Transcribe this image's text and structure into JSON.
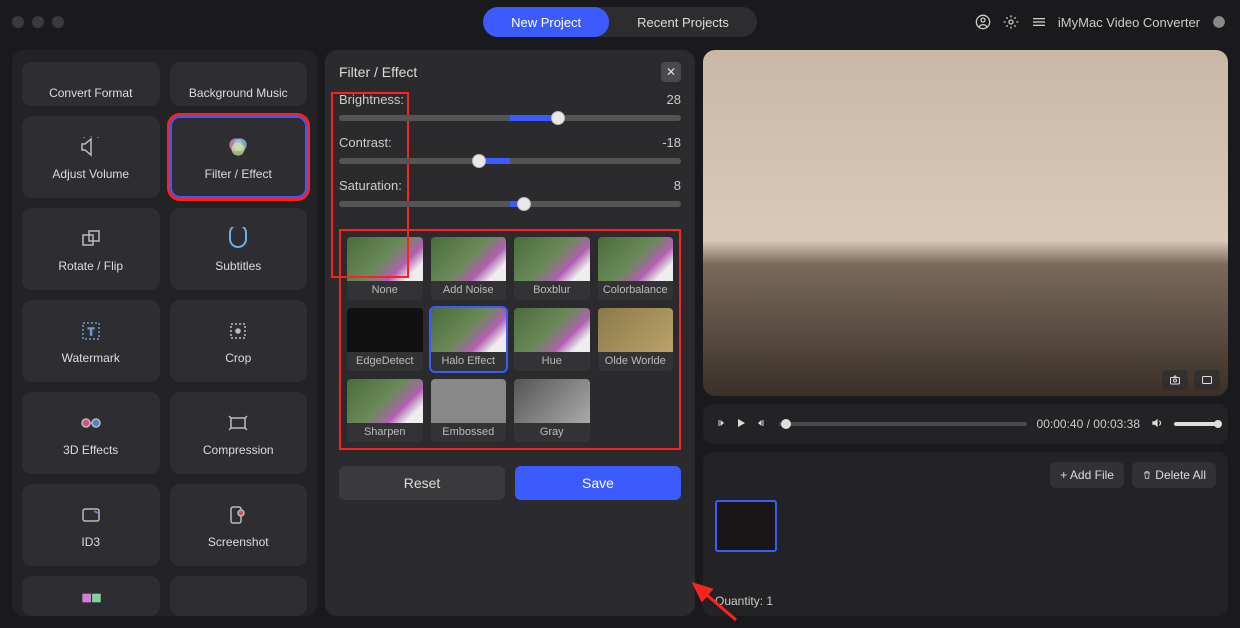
{
  "header": {
    "new_project": "New Project",
    "recent_projects": "Recent Projects",
    "app_name": "iMyMac Video Converter"
  },
  "sidebar": {
    "tools": [
      {
        "label": "Convert Format"
      },
      {
        "label": "Background Music"
      },
      {
        "label": "Adjust Volume"
      },
      {
        "label": "Filter / Effect"
      },
      {
        "label": "Rotate / Flip"
      },
      {
        "label": "Subtitles"
      },
      {
        "label": "Watermark"
      },
      {
        "label": "Crop"
      },
      {
        "label": "3D Effects"
      },
      {
        "label": "Compression"
      },
      {
        "label": "ID3"
      },
      {
        "label": "Screenshot"
      }
    ]
  },
  "editor": {
    "title": "Filter / Effect",
    "sliders": {
      "brightness": {
        "label": "Brightness:",
        "value": "28",
        "pct": 64
      },
      "contrast": {
        "label": "Contrast:",
        "value": "-18",
        "pct": 41
      },
      "saturation": {
        "label": "Saturation:",
        "value": "8",
        "pct": 54
      }
    },
    "filters": [
      "None",
      "Add Noise",
      "Boxblur",
      "Colorbalance",
      "EdgeDetect",
      "Halo Effect",
      "Hue",
      "Olde Worlde",
      "Sharpen",
      "Embossed",
      "Gray"
    ],
    "selected_filter": "Halo Effect",
    "reset": "Reset",
    "save": "Save"
  },
  "player": {
    "current": "00:00:40",
    "total": "00:03:38"
  },
  "queue": {
    "add_file": "+ Add File",
    "delete_all": "Delete All",
    "quantity_label": "Quantity:",
    "quantity": "1"
  }
}
